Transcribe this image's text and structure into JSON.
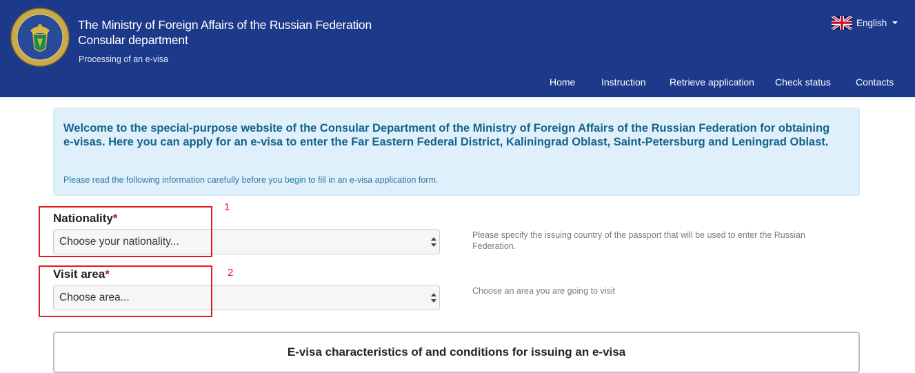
{
  "header": {
    "title_line1": "The Ministry of Foreign Affairs of the Russian Federation",
    "title_line2": "Consular department",
    "subtitle": "Processing of an e-visa",
    "language_label": "English",
    "language_icon": "uk-flag-icon",
    "emblem_icon": "consular-emblem-icon"
  },
  "nav": {
    "items": [
      {
        "label": "Home"
      },
      {
        "label": "Instruction"
      },
      {
        "label": "Retrieve application"
      },
      {
        "label": "Check status"
      },
      {
        "label": "Contacts"
      }
    ]
  },
  "alert": {
    "heading": "Welcome to the special-purpose website of the Consular Department of the Ministry of Foreign Affairs of the Russian Federation for obtaining e-visas. Here you can apply for an e-visa to enter the Far Eastern Federal District, Kaliningrad Oblast, Saint-Petersburg and Leningrad Oblast.",
    "note": "Please read the following information carefully before you begin to fill in an e-visa application form."
  },
  "form": {
    "required_mark": "*",
    "nationality": {
      "label": "Nationality",
      "selected": "Choose your nationality...",
      "help": "Please specify the issuing country of the passport that will be used to enter the Russian Federation."
    },
    "visit_area": {
      "label": "Visit area",
      "selected": "Choose area...",
      "help": "Choose an area you are going to visit"
    }
  },
  "annotations": {
    "callout1": "1",
    "callout2": "2",
    "color": "#e3191e"
  },
  "panel": {
    "title": "E-visa characteristics of and conditions for issuing an e-visa"
  },
  "colors": {
    "header_bg": "#1d3a8a",
    "alert_bg": "#dff0fb",
    "alert_text": "#15628c",
    "required": "#b52121"
  }
}
